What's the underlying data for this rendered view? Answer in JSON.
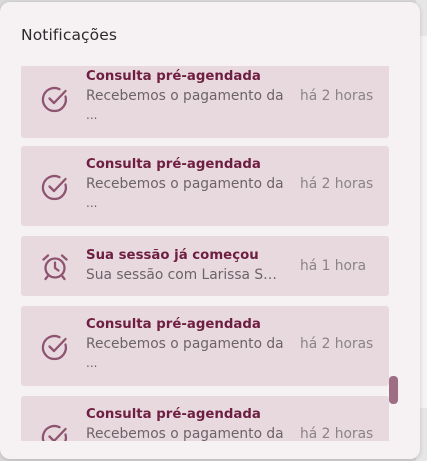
{
  "panel": {
    "title": "Notificações"
  },
  "notifications": [
    {
      "icon": "check-circle-icon",
      "title": "Consulta pré-agendada",
      "description": "Recebemos o pagamento da",
      "more": "...",
      "time": "há 2 horas"
    },
    {
      "icon": "check-circle-icon",
      "title": "Consulta pré-agendada",
      "description": "Recebemos o pagamento da",
      "more": "...",
      "time": "há 2 horas"
    },
    {
      "icon": "alarm-clock-icon",
      "title": "Sua sessão já começou",
      "description": "Sua sessão com Larissa Sa...",
      "time": "há 1 hora"
    },
    {
      "icon": "check-circle-icon",
      "title": "Consulta pré-agendada",
      "description": "Recebemos o pagamento da",
      "more": "...",
      "time": "há 2 horas"
    },
    {
      "icon": "check-circle-icon",
      "title": "Consulta pré-agendada",
      "description": "Recebemos o pagamento da",
      "more": "...",
      "time": "há 2 horas"
    }
  ],
  "colors": {
    "accent": "#6e1e40",
    "icon": "#8e5470",
    "card_background": "#e8d9df",
    "panel_background": "#f6f2f4",
    "scrollbar_thumb": "#9e6e84"
  }
}
